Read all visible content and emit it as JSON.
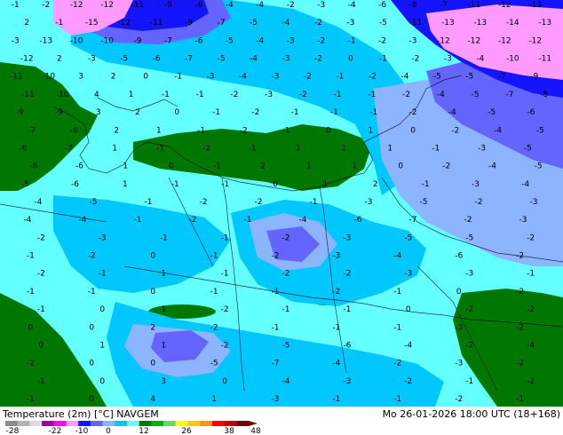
{
  "map": {
    "title": "Temperature (2m) [°C] NAVGEM",
    "valid_time": "Mo 26-01-2026 18:00 UTC (18+168)",
    "colorbar": {
      "ticks": [
        "-28",
        "-22",
        "-10",
        "0",
        "12",
        "26",
        "38",
        "48"
      ],
      "colors": [
        "#8c8c8c",
        "#b4b4b4",
        "#dcdcdc",
        "#a000a0",
        "#ff00ff",
        "#ff9bff",
        "#1414ff",
        "#6464ff",
        "#8cb4ff",
        "#00c8ff",
        "#64ffff",
        "#007800",
        "#00b400",
        "#64dc64",
        "#ffff00",
        "#ffc800",
        "#ff9600",
        "#ff0000",
        "#c80000",
        "#780000"
      ]
    },
    "field_colors": {
      "very_cold": "#ff9bff",
      "cold": "#1414ff",
      "cool": "#6464ff",
      "mild_blue": "#8cb4ff",
      "light_cyan": "#64ffff",
      "cyan": "#00c8ff",
      "green": "#007800"
    },
    "values": [
      {
        "v": "-1"
      },
      {
        "v": "-2"
      },
      {
        "v": "-12"
      },
      {
        "v": "-12"
      },
      {
        "v": "-11"
      },
      {
        "v": "-9"
      },
      {
        "v": "-6"
      },
      {
        "v": "-4"
      },
      {
        "v": "-4"
      },
      {
        "v": "-2"
      },
      {
        "v": "-3"
      },
      {
        "v": "-4"
      },
      {
        "v": "-6"
      },
      {
        "v": "-8"
      },
      {
        "v": "-7"
      },
      {
        "v": "-11"
      },
      {
        "v": "-12"
      },
      {
        "v": "-13"
      },
      {
        "v": "2"
      },
      {
        "v": "-1"
      },
      {
        "v": "-15"
      },
      {
        "v": "-12"
      },
      {
        "v": "-11"
      },
      {
        "v": "-9"
      },
      {
        "v": "-7"
      },
      {
        "v": "-5"
      },
      {
        "v": "-4"
      },
      {
        "v": "-2"
      },
      {
        "v": "-3"
      },
      {
        "v": "-5"
      },
      {
        "v": "-11"
      },
      {
        "v": "-13"
      },
      {
        "v": "-13"
      },
      {
        "v": "-14"
      },
      {
        "v": "-13"
      },
      {
        "v": "-3"
      },
      {
        "v": "-13"
      },
      {
        "v": "-10"
      },
      {
        "v": "-10"
      },
      {
        "v": "-9"
      },
      {
        "v": "-7"
      },
      {
        "v": "-6"
      },
      {
        "v": "-5"
      },
      {
        "v": "-4"
      },
      {
        "v": "-3"
      },
      {
        "v": "-2"
      },
      {
        "v": "-1"
      },
      {
        "v": "-2"
      },
      {
        "v": "-3"
      },
      {
        "v": "-12"
      },
      {
        "v": "-12"
      },
      {
        "v": "-12"
      },
      {
        "v": "-12"
      },
      {
        "v": "-12"
      },
      {
        "v": "2"
      },
      {
        "v": "-3"
      },
      {
        "v": "-5"
      },
      {
        "v": "-6"
      },
      {
        "v": "-7"
      },
      {
        "v": "-5"
      },
      {
        "v": "-4"
      },
      {
        "v": "-3"
      },
      {
        "v": "-2"
      },
      {
        "v": "0"
      },
      {
        "v": "-1"
      },
      {
        "v": "-2"
      },
      {
        "v": "-3"
      },
      {
        "v": "-4"
      },
      {
        "v": "-10"
      },
      {
        "v": "-11"
      },
      {
        "v": "-11"
      },
      {
        "v": "-10"
      },
      {
        "v": "3"
      },
      {
        "v": "2"
      },
      {
        "v": "0"
      },
      {
        "v": "-1"
      },
      {
        "v": "-3"
      },
      {
        "v": "-4"
      },
      {
        "v": "-3"
      },
      {
        "v": "-2"
      },
      {
        "v": "-1"
      },
      {
        "v": "-2"
      },
      {
        "v": "-4"
      },
      {
        "v": "-5"
      },
      {
        "v": "-5"
      },
      {
        "v": "-7"
      },
      {
        "v": "-9"
      },
      {
        "v": "-11"
      },
      {
        "v": "-10"
      },
      {
        "v": "4"
      },
      {
        "v": "1"
      },
      {
        "v": "-1"
      },
      {
        "v": "-1"
      },
      {
        "v": "-2"
      },
      {
        "v": "-3"
      },
      {
        "v": "-2"
      },
      {
        "v": "-1"
      },
      {
        "v": "-1"
      },
      {
        "v": "-2"
      },
      {
        "v": "-4"
      },
      {
        "v": "-5"
      },
      {
        "v": "-7"
      },
      {
        "v": "-8"
      },
      {
        "v": "-9"
      },
      {
        "v": "-9"
      },
      {
        "v": "3"
      },
      {
        "v": "2"
      },
      {
        "v": "0"
      },
      {
        "v": "-1"
      },
      {
        "v": "-2"
      },
      {
        "v": "-1"
      },
      {
        "v": "-1"
      },
      {
        "v": "-1"
      },
      {
        "v": "-2"
      },
      {
        "v": "-4"
      },
      {
        "v": "-5"
      },
      {
        "v": "-6"
      },
      {
        "v": "-7"
      },
      {
        "v": "-8"
      },
      {
        "v": "2"
      },
      {
        "v": "1"
      },
      {
        "v": "-1"
      },
      {
        "v": "-2"
      },
      {
        "v": "-1"
      },
      {
        "v": "0"
      },
      {
        "v": "1"
      },
      {
        "v": "0"
      },
      {
        "v": "-2"
      },
      {
        "v": "-4"
      },
      {
        "v": "-5"
      },
      {
        "v": "-6"
      },
      {
        "v": "-7"
      },
      {
        "v": "1"
      },
      {
        "v": "-1"
      },
      {
        "v": "-2"
      },
      {
        "v": "-1"
      },
      {
        "v": "1"
      },
      {
        "v": "1"
      },
      {
        "v": "1"
      },
      {
        "v": "-1"
      },
      {
        "v": "-3"
      },
      {
        "v": "-5"
      },
      {
        "v": "-6"
      },
      {
        "v": "-6"
      },
      {
        "v": "1"
      },
      {
        "v": "0"
      },
      {
        "v": "-1"
      },
      {
        "v": "2"
      },
      {
        "v": "1"
      },
      {
        "v": "1"
      },
      {
        "v": "0"
      },
      {
        "v": "-2"
      },
      {
        "v": "-4"
      },
      {
        "v": "-5"
      },
      {
        "v": "-5"
      },
      {
        "v": "-6"
      },
      {
        "v": "1"
      },
      {
        "v": "-1"
      },
      {
        "v": "-1"
      },
      {
        "v": "0"
      },
      {
        "v": "1"
      },
      {
        "v": "2"
      },
      {
        "v": "-1"
      },
      {
        "v": "-3"
      },
      {
        "v": "-4"
      },
      {
        "v": "-4"
      },
      {
        "v": "-5"
      },
      {
        "v": "-1"
      },
      {
        "v": "-2"
      },
      {
        "v": "-2"
      },
      {
        "v": "-1"
      },
      {
        "v": "-3"
      },
      {
        "v": "-5"
      },
      {
        "v": "-2"
      },
      {
        "v": "-3"
      },
      {
        "v": "-4"
      },
      {
        "v": "-4"
      },
      {
        "v": "-1"
      },
      {
        "v": "-2"
      },
      {
        "v": "-1"
      },
      {
        "v": "-4"
      },
      {
        "v": "-6"
      },
      {
        "v": "-7"
      },
      {
        "v": "-2"
      },
      {
        "v": "-3"
      },
      {
        "v": "-2"
      },
      {
        "v": "-3"
      },
      {
        "v": "-1"
      },
      {
        "v": "-1"
      },
      {
        "v": "-2"
      },
      {
        "v": "-3"
      },
      {
        "v": "-5"
      },
      {
        "v": "-5"
      },
      {
        "v": "-2"
      },
      {
        "v": "-1"
      },
      {
        "v": "-2"
      },
      {
        "v": "0"
      },
      {
        "v": "-1"
      },
      {
        "v": "-2"
      },
      {
        "v": "-3"
      },
      {
        "v": "-4"
      },
      {
        "v": "-6"
      },
      {
        "v": "-2"
      },
      {
        "v": "-2"
      },
      {
        "v": "-1"
      },
      {
        "v": "1"
      },
      {
        "v": "-1"
      },
      {
        "v": "-2"
      },
      {
        "v": "-2"
      },
      {
        "v": "-3"
      },
      {
        "v": "-3"
      },
      {
        "v": "-1"
      },
      {
        "v": "-1"
      },
      {
        "v": "-1"
      },
      {
        "v": "0"
      },
      {
        "v": "-1"
      },
      {
        "v": "-1"
      },
      {
        "v": "-2"
      },
      {
        "v": "-1"
      },
      {
        "v": "0"
      },
      {
        "v": "-2"
      },
      {
        "v": "-1"
      },
      {
        "v": "0"
      },
      {
        "v": "1"
      },
      {
        "v": "-2"
      },
      {
        "v": "-1"
      },
      {
        "v": "-1"
      },
      {
        "v": "0"
      },
      {
        "v": "-2"
      },
      {
        "v": "-2"
      },
      {
        "v": "0"
      },
      {
        "v": "0"
      },
      {
        "v": "2"
      },
      {
        "v": "-2"
      },
      {
        "v": "-1"
      },
      {
        "v": "-1"
      },
      {
        "v": "-1"
      },
      {
        "v": "-3"
      },
      {
        "v": "-2"
      },
      {
        "v": "0"
      },
      {
        "v": "1"
      },
      {
        "v": "1"
      },
      {
        "v": "-2"
      },
      {
        "v": "-5"
      },
      {
        "v": "-6"
      },
      {
        "v": "-4"
      },
      {
        "v": "-2"
      },
      {
        "v": "-4"
      },
      {
        "v": "-2"
      },
      {
        "v": "0"
      },
      {
        "v": "0"
      },
      {
        "v": "-5"
      },
      {
        "v": "-7"
      },
      {
        "v": "-4"
      },
      {
        "v": "-2"
      },
      {
        "v": "-3"
      },
      {
        "v": "-2"
      },
      {
        "v": "-1"
      },
      {
        "v": "0"
      },
      {
        "v": "3"
      },
      {
        "v": "0"
      },
      {
        "v": "-4"
      },
      {
        "v": "-3"
      },
      {
        "v": "-2"
      },
      {
        "v": "-1"
      },
      {
        "v": "-2"
      },
      {
        "v": "-1"
      },
      {
        "v": "0"
      },
      {
        "v": "4"
      },
      {
        "v": "1"
      },
      {
        "v": "-3"
      },
      {
        "v": "-1"
      },
      {
        "v": "-1"
      },
      {
        "v": "-2"
      },
      {
        "v": "-1"
      },
      {
        "v": "-2"
      },
      {
        "v": "-1"
      }
    ]
  }
}
